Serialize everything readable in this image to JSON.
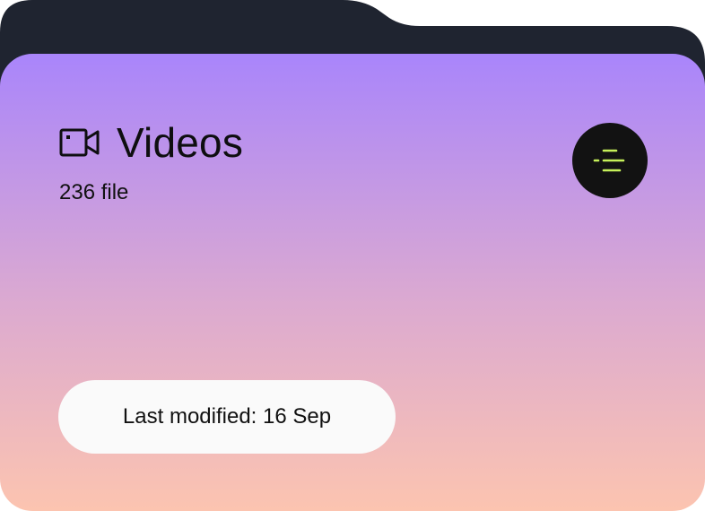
{
  "folder": {
    "title": "Videos",
    "file_count": "236 file",
    "last_modified": "Last modified: 16 Sep",
    "icon": "video-camera-icon",
    "menu_icon": "menu-lines-icon"
  },
  "colors": {
    "tab_dark": "#1f2430",
    "gradient_top": "#a985fb",
    "gradient_mid": "#dcaad0",
    "gradient_bottom": "#fcc4b0",
    "menu_button_bg": "#121212",
    "menu_icon_accent": "#c6f05a",
    "pill_bg": "#fafafa"
  }
}
